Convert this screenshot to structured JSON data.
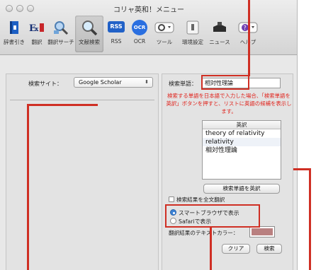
{
  "window": {
    "title": "コリャ英和！メニュー"
  },
  "toolbar": {
    "items": [
      {
        "label": "辞書引き",
        "icon": "dictionary-icon"
      },
      {
        "label": "翻訳",
        "icon": "translate-icon"
      },
      {
        "label": "翻訳サーチ",
        "icon": "translation-search-icon"
      },
      {
        "label": "文献検索",
        "icon": "magnifier-icon"
      },
      {
        "label": "RSS",
        "icon": "rss-icon"
      },
      {
        "label": "OCR",
        "icon": "ocr-icon"
      },
      {
        "label": "ツール",
        "icon": "tools-icon"
      },
      {
        "label": "環境設定",
        "icon": "preferences-icon"
      },
      {
        "label": "ニュース",
        "icon": "news-icon"
      },
      {
        "label": "ヘルプ",
        "icon": "help-icon"
      }
    ],
    "rss_badge": "RSS",
    "ocr_badge": "OCR",
    "ex_badge": "ExJ"
  },
  "left": {
    "site_label": "検索サイト：",
    "site_value": "Google Scholar"
  },
  "right": {
    "word_label": "検索単語：",
    "word_value": "相対性理論",
    "hint": "検索する単語を日本語で入力した場合、「検索単語を英訳」ボタンを押すと、リストに英語の候補を表示します。",
    "results_header": "英訳",
    "results": [
      "theory of relativity",
      "relativity",
      "相対性理論"
    ],
    "translate_button": "検索単語を英訳",
    "fulltext_checkbox": "検索結果を全文翻訳",
    "radio_smart": "スマートブラウザで表示",
    "radio_safari": "Safariで表示",
    "color_label": "翻訳結果のテキストカラー：",
    "text_color": "#b98080",
    "clear_button": "クリア",
    "search_button": "検索"
  },
  "annotation_color": "#cf2f24"
}
